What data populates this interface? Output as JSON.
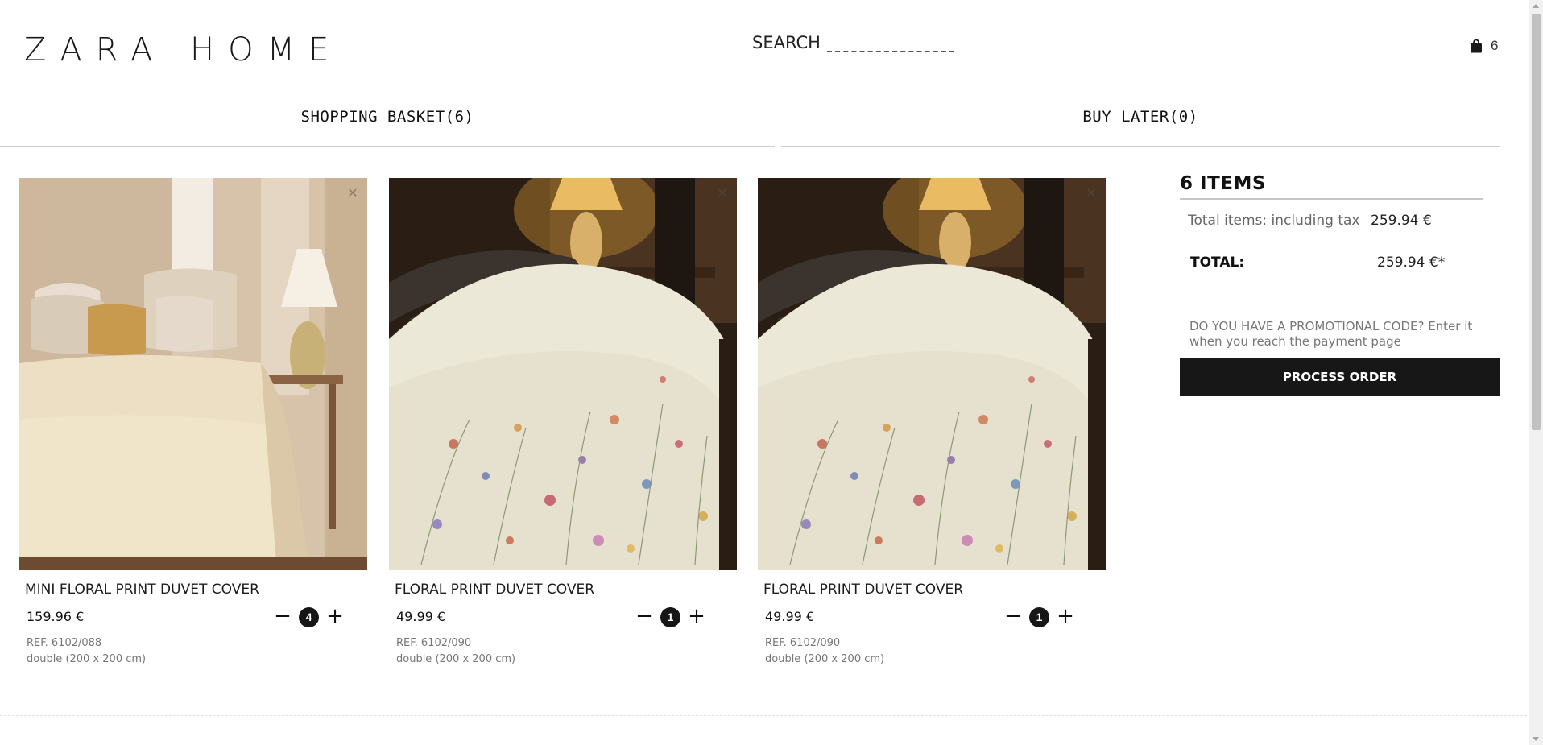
{
  "header": {
    "logo": "ZARA HOME",
    "search_label": "SEARCH",
    "cart_count": "6"
  },
  "tabs": [
    {
      "label": "SHOPPING BASKET(6)"
    },
    {
      "label": "BUY LATER(0)"
    }
  ],
  "products": [
    {
      "name": "MINI FLORAL PRINT DUVET COVER",
      "price": "159.96 €",
      "quantity": "4",
      "ref": "REF. 6102/088",
      "size": "double (200 x 200 cm)",
      "remove_icon": "close-icon"
    },
    {
      "name": "FLORAL PRINT DUVET COVER",
      "price": "49.99 €",
      "quantity": "1",
      "ref": "REF. 6102/090",
      "size": "double (200 x 200 cm)",
      "remove_icon": "close-icon"
    },
    {
      "name": "FLORAL PRINT DUVET COVER",
      "price": "49.99 €",
      "quantity": "1",
      "ref": "REF. 6102/090",
      "size": "double (200 x 200 cm)",
      "remove_icon": "close-icon"
    }
  ],
  "qty_controls": {
    "minus": "−",
    "plus": "+"
  },
  "summary": {
    "title": "6 ITEMS",
    "items_label": "Total items: including tax",
    "items_value": "259.94 €",
    "total_label": "TOTAL:",
    "total_value": "259.94 €*",
    "promo_text": "DO YOU HAVE A PROMOTIONAL CODE? Enter it when you reach the payment page",
    "process_button": "PROCESS ORDER"
  },
  "colors": {
    "accent": "#171717",
    "muted_text": "#777777"
  }
}
